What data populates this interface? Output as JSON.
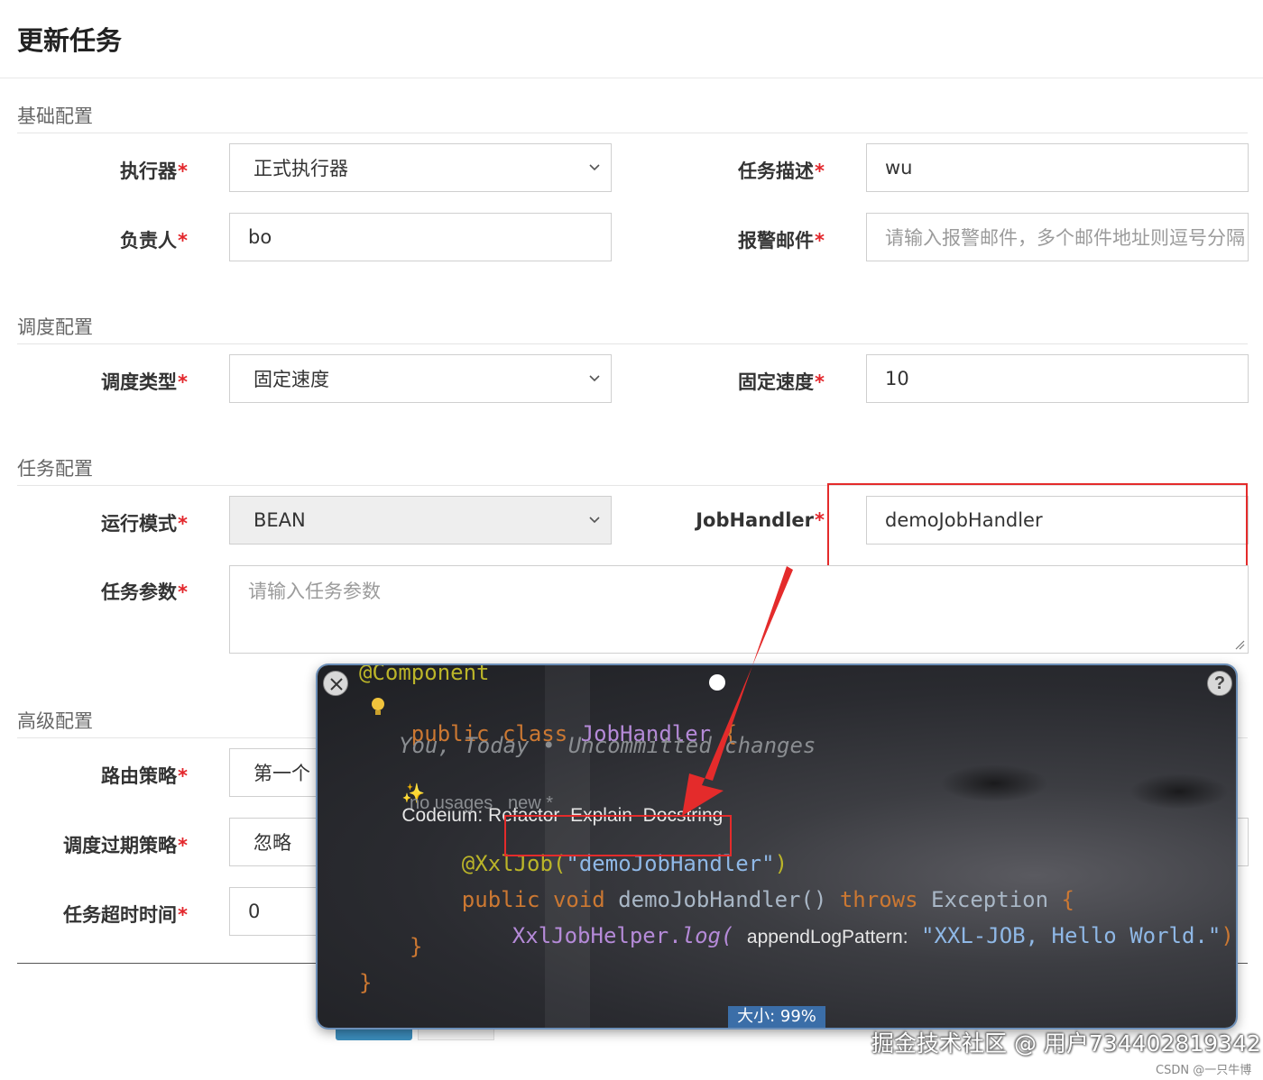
{
  "page": {
    "title": "更新任务"
  },
  "sections": {
    "basic": "基础配置",
    "schedule": "调度配置",
    "task": "任务配置",
    "advanced": "高级配置"
  },
  "fields": {
    "executor": {
      "label": "执行器",
      "value": "正式执行器"
    },
    "desc": {
      "label": "任务描述",
      "value": "wu"
    },
    "owner": {
      "label": "负责人",
      "value": "bo"
    },
    "alarm": {
      "label": "报警邮件",
      "placeholder": "请输入报警邮件，多个邮件地址则逗号分隔"
    },
    "schedule_type": {
      "label": "调度类型",
      "value": "固定速度"
    },
    "fixed_rate": {
      "label": "固定速度",
      "value": "10"
    },
    "run_mode": {
      "label": "运行模式",
      "value": "BEAN"
    },
    "job_handler": {
      "label": "JobHandler",
      "value": "demoJobHandler"
    },
    "params": {
      "label": "任务参数",
      "placeholder": "请输入任务参数"
    },
    "route": {
      "label": "路由策略",
      "value": "第一个"
    },
    "misfire": {
      "label": "调度过期策略",
      "value": "忽略"
    },
    "timeout": {
      "label": "任务超时时间",
      "value": "0"
    }
  },
  "required_mark": "*",
  "popup": {
    "line_component": "@Component",
    "line_class_kw": "public class",
    "line_class_name": "JobHandler",
    "line_class_brace": "{",
    "line_blame": "You, Today • Uncommitted changes",
    "line_codeium_icon": "✨",
    "line_codeium": "Codeium: Refactor  Explain  Docstring",
    "line_usages": "no usages   new *",
    "line_anno_name": "@XxlJob(",
    "line_anno_str": "\"demoJobHandler\"",
    "line_anno_close": ")",
    "line_method_kw": "public void",
    "line_method_name": "demoJobHandler()",
    "line_method_throws": "throws",
    "line_method_exc": "Exception",
    "line_method_brace": "{",
    "line_log_cls": "XxlJobHelper.",
    "line_log_fn": "log(",
    "line_log_param": "appendLogPattern:",
    "line_log_str": "\"XXL-JOB, Hello World.\"",
    "line_log_end": ");",
    "line_close1": "}",
    "line_close2": "}",
    "help_label": "?",
    "size_label": "大小: 99%"
  },
  "watermark": "掘金技术社区 @ 用户734402819342",
  "csdn": "CSDN @一只牛博",
  "colors": {
    "required": "#e3262b",
    "highlight": "#e42b2b",
    "primary": "#3c8dbc"
  }
}
